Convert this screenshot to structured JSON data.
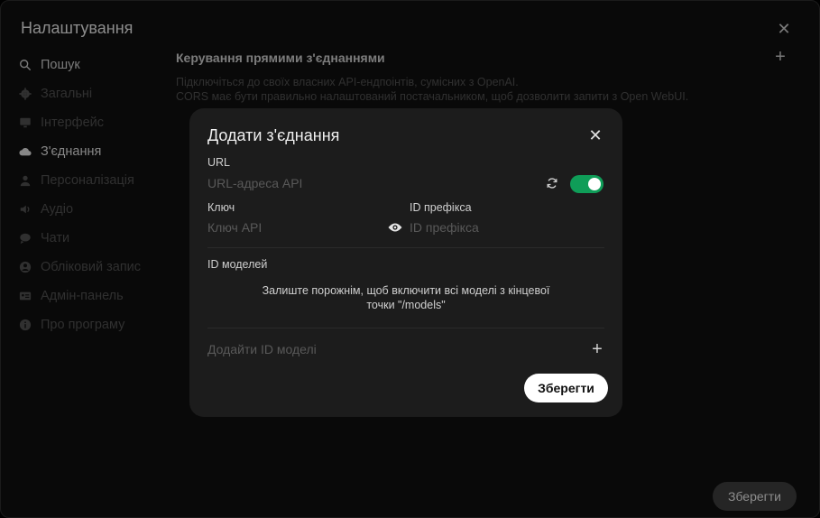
{
  "settings": {
    "title": "Налаштування",
    "close_icon": "close-icon",
    "sidebar": {
      "search_label": "Пошук",
      "items": [
        {
          "label": "Загальні",
          "icon": "gear-icon"
        },
        {
          "label": "Інтерфейс",
          "icon": "monitor-icon"
        },
        {
          "label": "З'єднання",
          "icon": "cloud-icon"
        },
        {
          "label": "Персоналізація",
          "icon": "user-icon"
        },
        {
          "label": "Аудіо",
          "icon": "speaker-icon"
        },
        {
          "label": "Чати",
          "icon": "chat-icon"
        },
        {
          "label": "Обліковий запис",
          "icon": "account-circle-icon"
        },
        {
          "label": "Адмін-панель",
          "icon": "id-card-icon"
        },
        {
          "label": "Про програму",
          "icon": "info-icon"
        }
      ]
    },
    "main": {
      "heading": "Керування прямими з'єднаннями",
      "desc_line1": "Підключіться до своїх власних API-ендпоінтів, сумісних з OpenAI.",
      "desc_line2": "CORS має бути правильно налаштований постачальником, щоб дозволити запити з Open WebUI."
    },
    "save_label": "Зберегти"
  },
  "modal": {
    "title": "Додати з'єднання",
    "url_label": "URL",
    "url_placeholder": "URL-адреса API",
    "url_value": "",
    "enabled": true,
    "key_label": "Ключ",
    "key_placeholder": "Ключ API",
    "prefix_label": "ID префікса",
    "prefix_placeholder": "ID префікса",
    "models_label": "ID моделей",
    "models_hint_line1": "Залиште порожнім, щоб включити всі моделі з кінцевої",
    "models_hint_line2": "точки \"/models\"",
    "add_model_placeholder": "Додайти ID моделі",
    "save_label": "Зберегти"
  },
  "colors": {
    "toggle_on": "#0f9d58",
    "modal_bg": "#1c1c1c",
    "page_bg": "#0f0f0f"
  }
}
